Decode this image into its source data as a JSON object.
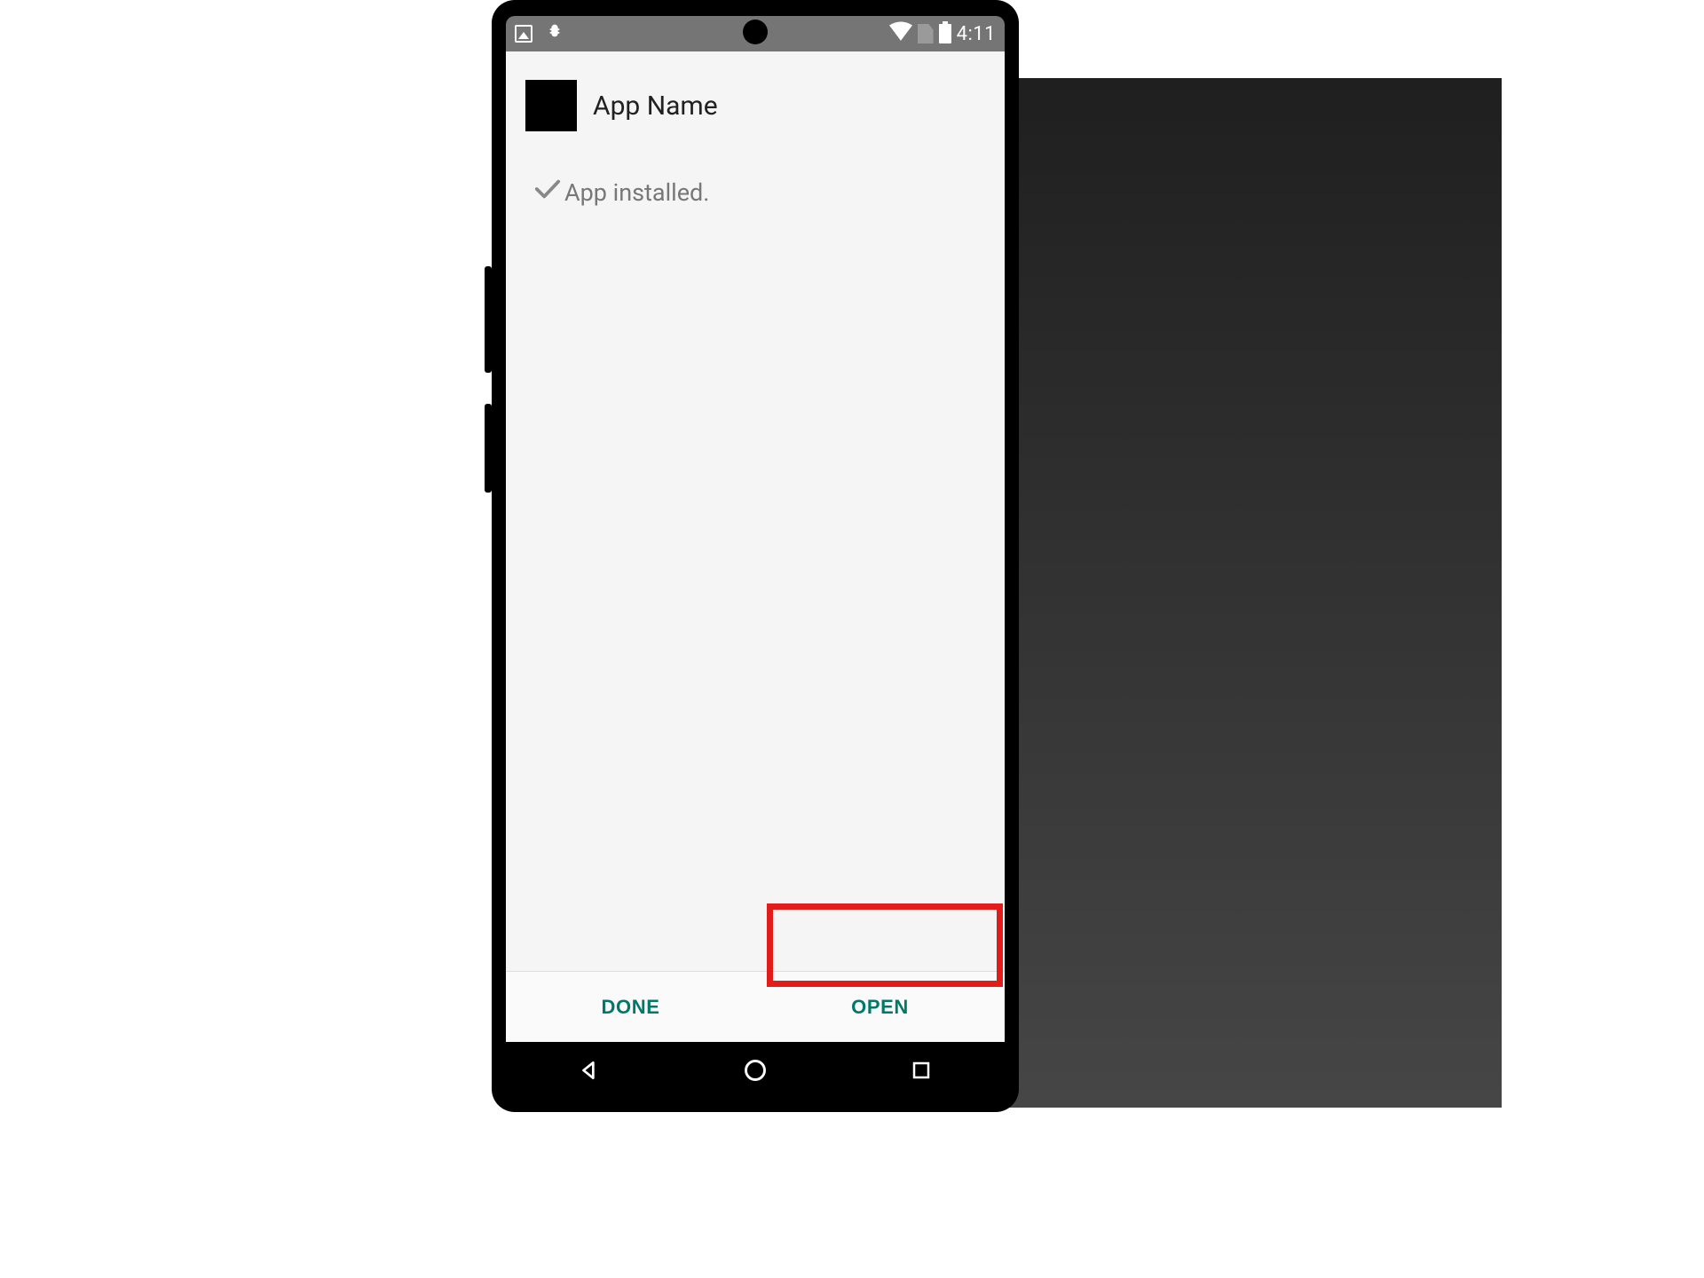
{
  "statusbar": {
    "time": "4:11"
  },
  "header": {
    "app_name": "App Name"
  },
  "status": {
    "message": "App installed."
  },
  "footer": {
    "done_label": "DONE",
    "open_label": "OPEN"
  },
  "colors": {
    "accent": "#00796b",
    "highlight": "#e21b1b"
  }
}
